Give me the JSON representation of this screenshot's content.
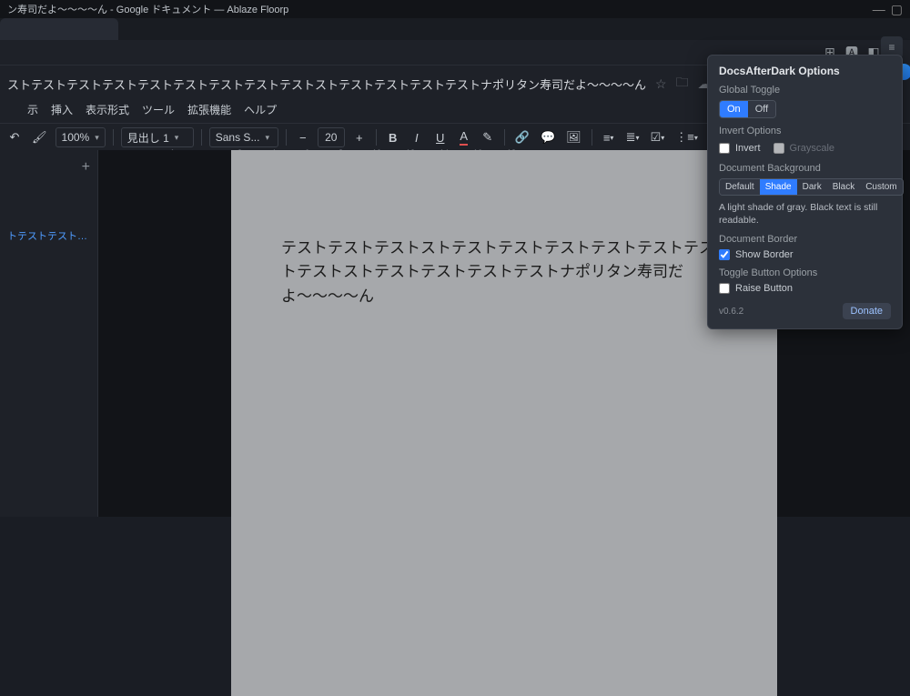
{
  "window": {
    "title": "ン寿司だよ〜〜〜〜ん - Google ドキュメント — Ablaze Floorp"
  },
  "doc": {
    "title": "ストテストテストテストテストテストテストテストテストストテストテストテストテストナポリタン寿司だよ〜〜〜〜ん",
    "menus": [
      "示",
      "挿入",
      "表示形式",
      "ツール",
      "拡張機能",
      "ヘルプ"
    ]
  },
  "toolbar": {
    "zoom": "100%",
    "style": "見出し 1",
    "font": "Sans S...",
    "size": "20"
  },
  "outline": {
    "item1": "トテストテストテ..."
  },
  "page": {
    "text": "テストテストテストストテストテストテストテストテストテストテストストテストテストテストテストナポリタン寿司だよ〜〜〜〜ん"
  },
  "popup": {
    "title": "DocsAfterDark Options",
    "global_label": "Global Toggle",
    "on": "On",
    "off": "Off",
    "invert_label": "Invert Options",
    "invert": "Invert",
    "grayscale": "Grayscale",
    "bg_label": "Document Background",
    "bg_opts": [
      "Default",
      "Shade",
      "Dark",
      "Black",
      "Custom"
    ],
    "bg_active": 1,
    "bg_desc": "A light shade of gray. Black text is still readable.",
    "border_label": "Document Border",
    "show_border": "Show Border",
    "tbtn_label": "Toggle Button Options",
    "raise": "Raise Button",
    "version": "v0.6.2",
    "donate": "Donate"
  }
}
